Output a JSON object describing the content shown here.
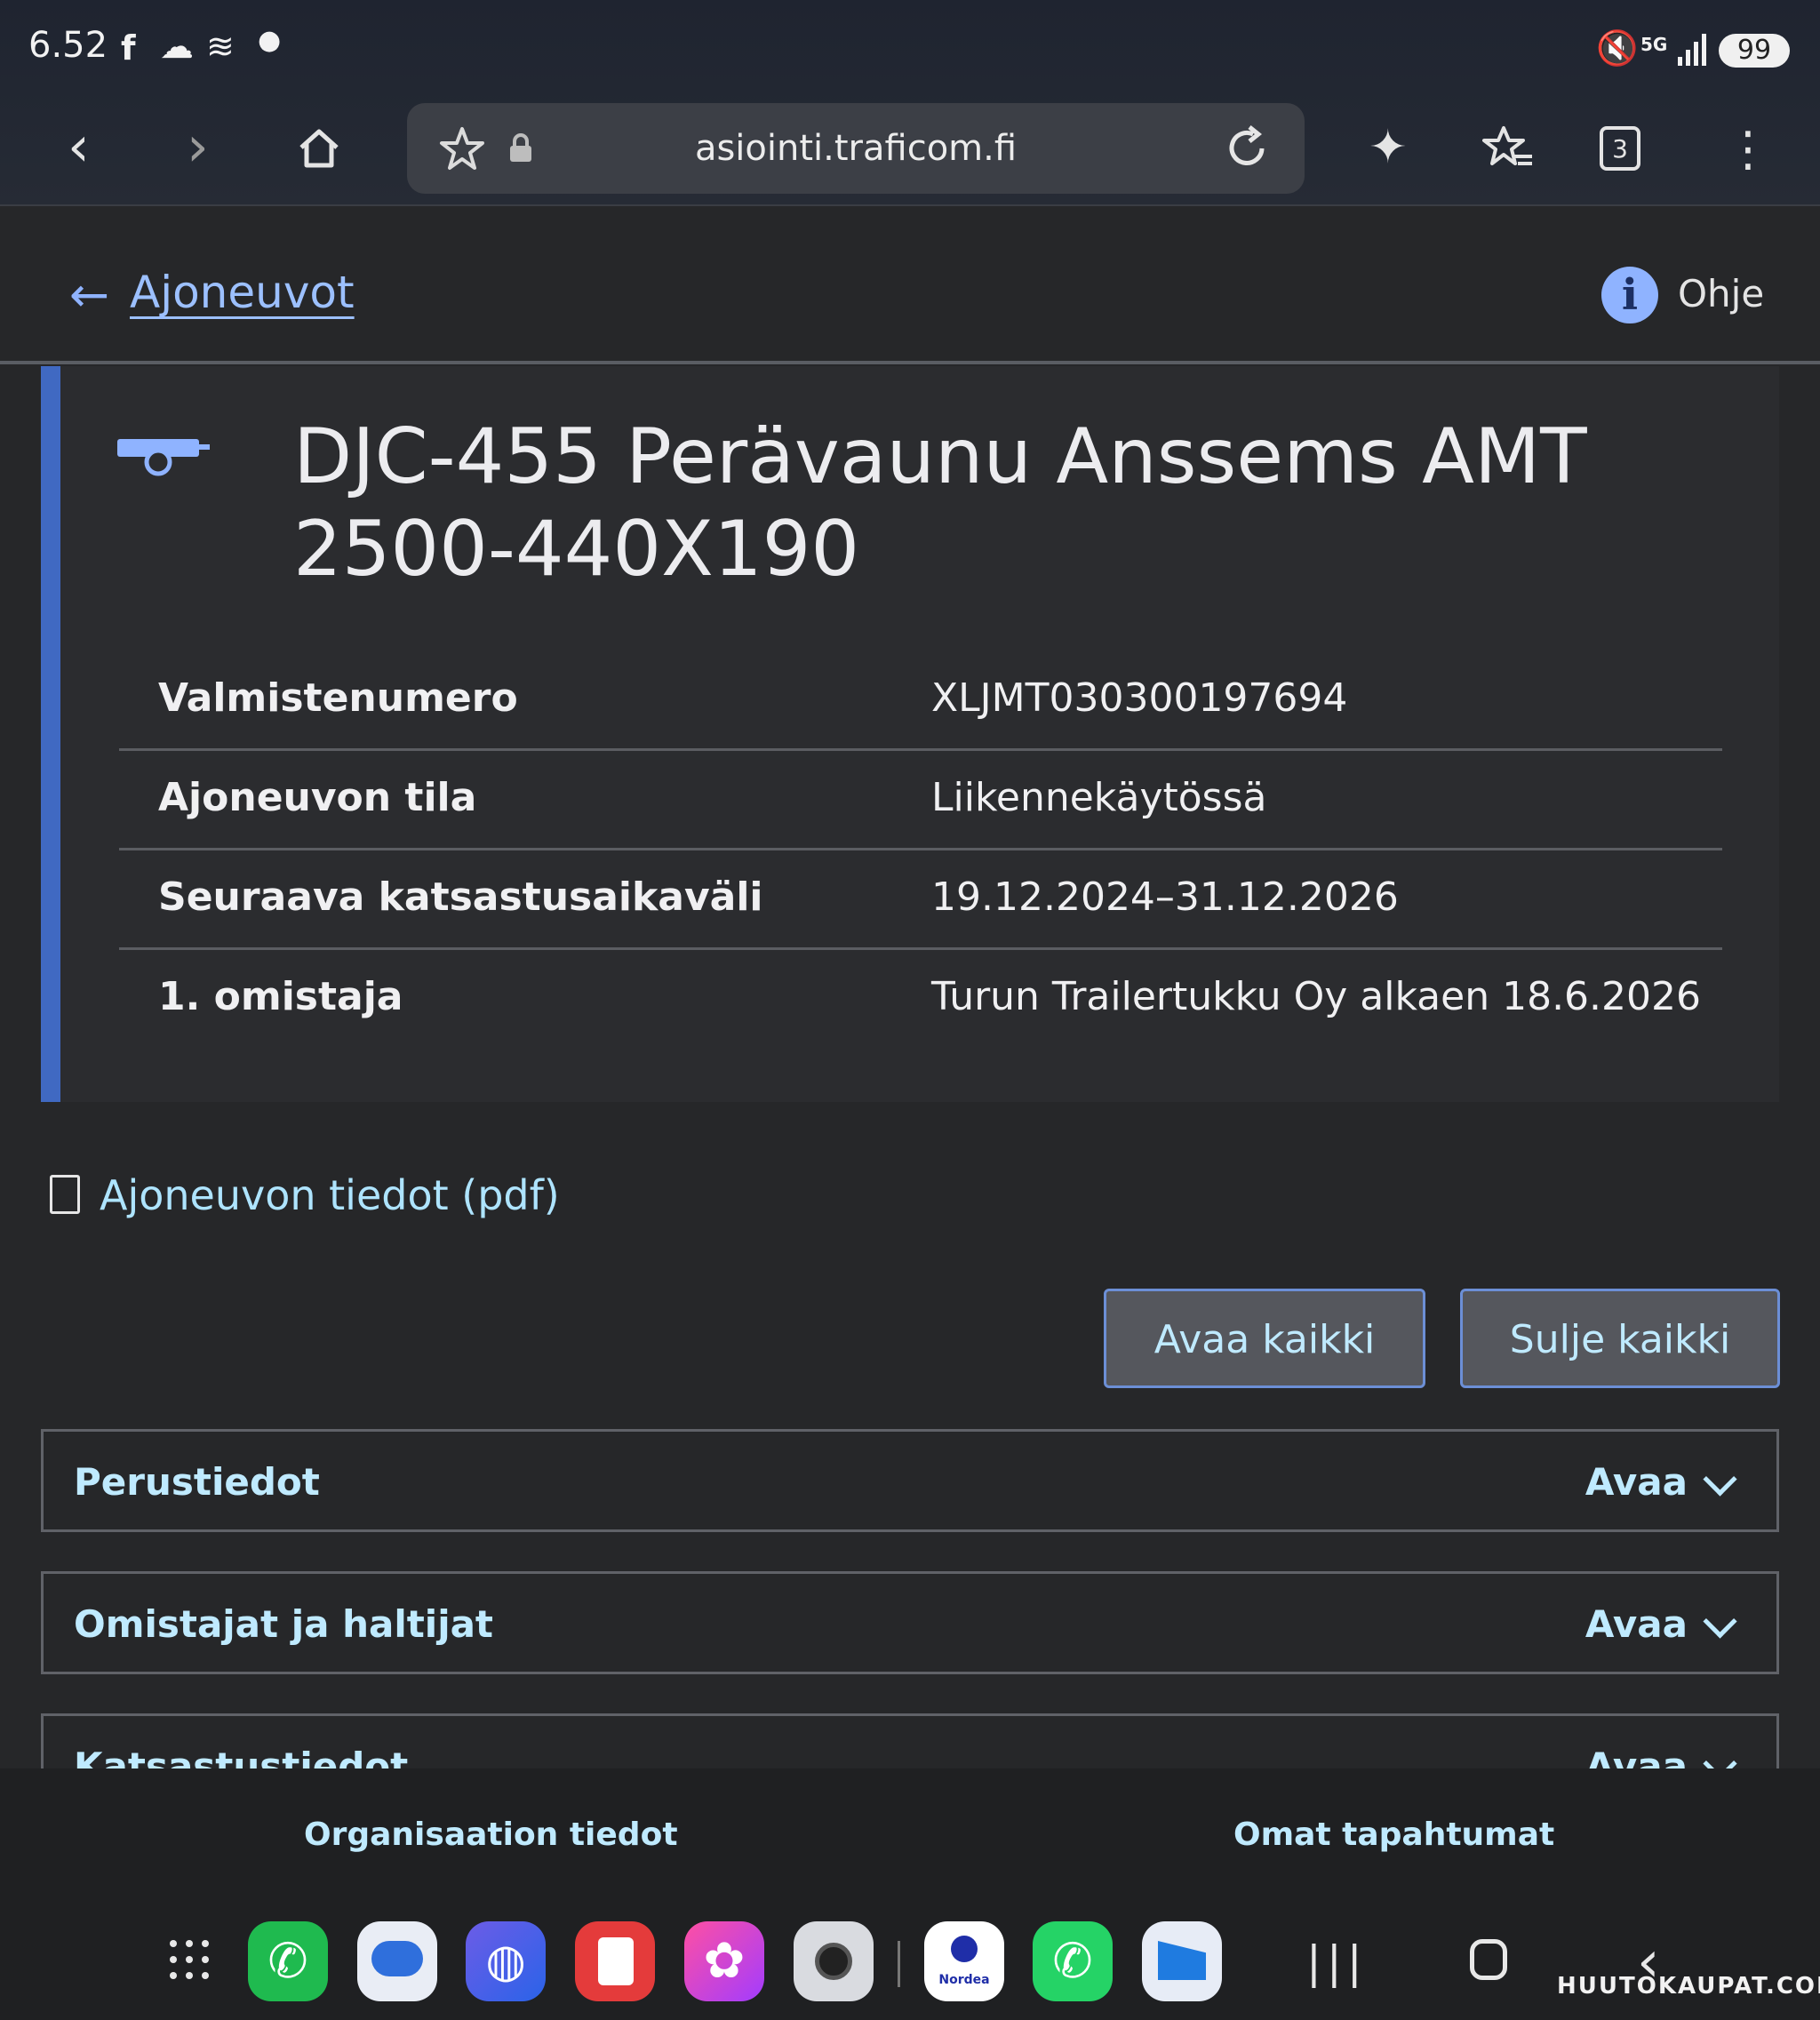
{
  "status_bar": {
    "time": "6.52",
    "icons": [
      "facebook-icon",
      "cloud-icon",
      "fog-icon",
      "dot-icon",
      "mute-icon",
      "5g-icon",
      "signal-icon"
    ],
    "battery": "99"
  },
  "browser": {
    "url": "asiointi.traficom.fi",
    "tab_count": "3"
  },
  "header": {
    "back_label": "Ajoneuvot",
    "help_label": "Ohje",
    "info_glyph": "i"
  },
  "vehicle": {
    "title": "DJC-455 Perävaunu Anssems AMT 2500-440X190",
    "details": [
      {
        "label": "Valmistenumero",
        "value": "XLJMT030300197694"
      },
      {
        "label": "Ajoneuvon tila",
        "value": "Liikennekäytössä"
      },
      {
        "label": "Seuraava katsastusaikaväli",
        "value": "19.12.2024–31.12.2026"
      },
      {
        "label": "1. omistaja",
        "value": "Turun Trailertukku Oy alkaen 18.6.2026"
      }
    ]
  },
  "pdf_link": "Ajoneuvon tiedot (pdf)",
  "buttons": {
    "open_all": "Avaa kaikki",
    "close_all": "Sulje kaikki"
  },
  "sections": [
    {
      "title": "Perustiedot",
      "action": "Avaa"
    },
    {
      "title": "Omistajat ja haltijat",
      "action": "Avaa"
    },
    {
      "title": "Katsastustiedot",
      "action": "Avaa"
    }
  ],
  "footer": {
    "org_link": "Organisaation tiedot",
    "events_link": "Omat tapahtumat"
  },
  "dock": {
    "nordea_label": "Nordea",
    "watermark": "HUUTOKAUPAT.COM"
  },
  "colors": {
    "accent": "#4069c2",
    "link": "#9cc0ff",
    "section_text": "#bfeaff"
  }
}
